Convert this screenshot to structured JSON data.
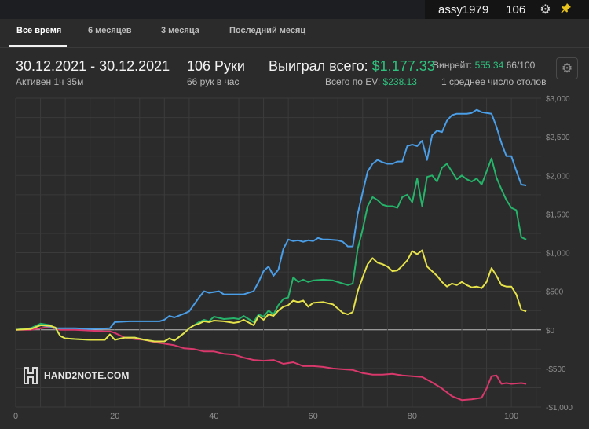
{
  "user": {
    "name": "assy1979",
    "hands": "106"
  },
  "tabs": [
    {
      "label": "Все время",
      "active": true
    },
    {
      "label": "6 месяцев",
      "active": false
    },
    {
      "label": "3 месяца",
      "active": false
    },
    {
      "label": "Последний месяц",
      "active": false
    }
  ],
  "summary": {
    "date_range": "30.12.2021 - 30.12.2021",
    "active": "Активен 1ч 35м",
    "hands": "106 Руки",
    "hands_rate": "66 рук в час",
    "won_label": "Выиграл всего: ",
    "won_value": "$1,177.33",
    "ev_label": "Всего по EV: ",
    "ev_value": "$238.13",
    "winrate_label": "Винрейт: ",
    "winrate_value": "555.34",
    "winrate_suffix": " 66/100",
    "tables": "1 среднее число столов"
  },
  "logo_text": "HAND2NOTE.COM",
  "colors": {
    "background": "#2b2b2b",
    "accent_green": "#2ec27e",
    "series_blue": "#4a9ee8",
    "series_green": "#25b46a",
    "series_yellow": "#e6e24a",
    "series_red": "#d8386b"
  },
  "chart_data": {
    "type": "line",
    "grid": true,
    "xlim": [
      0,
      106
    ],
    "ylim": [
      -1000,
      3000
    ],
    "x_ticks": [
      "0",
      "20",
      "40",
      "60",
      "80",
      "100"
    ],
    "y_ticks": [
      "$3,000",
      "$2,500",
      "$2,000",
      "$1,500",
      "$1,000",
      "$500",
      "$0",
      "-$500",
      "-$1,000"
    ],
    "series": [
      {
        "color": "#4a9ee8",
        "points": [
          [
            0,
            0
          ],
          [
            3,
            20
          ],
          [
            5,
            60
          ],
          [
            7,
            40
          ],
          [
            8,
            20
          ],
          [
            12,
            20
          ],
          [
            15,
            10
          ],
          [
            19,
            20
          ],
          [
            20,
            100
          ],
          [
            23,
            110
          ],
          [
            27,
            110
          ],
          [
            29,
            110
          ],
          [
            30,
            130
          ],
          [
            31,
            180
          ],
          [
            32,
            160
          ],
          [
            34,
            210
          ],
          [
            35,
            240
          ],
          [
            37,
            420
          ],
          [
            38,
            500
          ],
          [
            39,
            480
          ],
          [
            41,
            500
          ],
          [
            42,
            460
          ],
          [
            44,
            460
          ],
          [
            46,
            460
          ],
          [
            48,
            500
          ],
          [
            49,
            620
          ],
          [
            50,
            760
          ],
          [
            51,
            820
          ],
          [
            52,
            700
          ],
          [
            53,
            780
          ],
          [
            54,
            1050
          ],
          [
            55,
            1170
          ],
          [
            56,
            1150
          ],
          [
            57,
            1160
          ],
          [
            58,
            1140
          ],
          [
            59,
            1160
          ],
          [
            60,
            1150
          ],
          [
            61,
            1190
          ],
          [
            62,
            1170
          ],
          [
            63,
            1170
          ],
          [
            65,
            1160
          ],
          [
            66,
            1140
          ],
          [
            67,
            1080
          ],
          [
            68,
            1080
          ],
          [
            69,
            1500
          ],
          [
            70,
            1780
          ],
          [
            71,
            2050
          ],
          [
            72,
            2150
          ],
          [
            73,
            2200
          ],
          [
            74,
            2170
          ],
          [
            75,
            2150
          ],
          [
            76,
            2150
          ],
          [
            77,
            2180
          ],
          [
            78,
            2180
          ],
          [
            79,
            2380
          ],
          [
            80,
            2400
          ],
          [
            81,
            2380
          ],
          [
            82,
            2450
          ],
          [
            83,
            2200
          ],
          [
            84,
            2520
          ],
          [
            85,
            2580
          ],
          [
            86,
            2560
          ],
          [
            87,
            2710
          ],
          [
            88,
            2780
          ],
          [
            89,
            2800
          ],
          [
            90,
            2800
          ],
          [
            91,
            2800
          ],
          [
            92,
            2810
          ],
          [
            93,
            2850
          ],
          [
            94,
            2820
          ],
          [
            96,
            2800
          ],
          [
            97,
            2630
          ],
          [
            98,
            2420
          ],
          [
            99,
            2250
          ],
          [
            100,
            2250
          ],
          [
            101,
            2060
          ],
          [
            102,
            1880
          ],
          [
            103,
            1870
          ]
        ]
      },
      {
        "color": "#25b46a",
        "points": [
          [
            0,
            0
          ],
          [
            3,
            20
          ],
          [
            5,
            80
          ],
          [
            7,
            60
          ],
          [
            8,
            20
          ],
          [
            9,
            -80
          ],
          [
            10,
            -110
          ],
          [
            12,
            -120
          ],
          [
            15,
            -130
          ],
          [
            18,
            -130
          ],
          [
            19,
            -60
          ],
          [
            20,
            -130
          ],
          [
            22,
            -100
          ],
          [
            24,
            -100
          ],
          [
            26,
            -130
          ],
          [
            28,
            -150
          ],
          [
            30,
            -150
          ],
          [
            31,
            -110
          ],
          [
            32,
            -140
          ],
          [
            33,
            -90
          ],
          [
            34,
            -40
          ],
          [
            35,
            20
          ],
          [
            36,
            60
          ],
          [
            37,
            100
          ],
          [
            38,
            130
          ],
          [
            39,
            110
          ],
          [
            40,
            170
          ],
          [
            42,
            140
          ],
          [
            44,
            150
          ],
          [
            45,
            140
          ],
          [
            46,
            180
          ],
          [
            48,
            100
          ],
          [
            49,
            200
          ],
          [
            50,
            170
          ],
          [
            51,
            250
          ],
          [
            52,
            200
          ],
          [
            53,
            320
          ],
          [
            54,
            400
          ],
          [
            55,
            420
          ],
          [
            56,
            680
          ],
          [
            57,
            620
          ],
          [
            58,
            650
          ],
          [
            59,
            620
          ],
          [
            60,
            640
          ],
          [
            62,
            650
          ],
          [
            64,
            640
          ],
          [
            66,
            600
          ],
          [
            67,
            580
          ],
          [
            68,
            600
          ],
          [
            69,
            1050
          ],
          [
            70,
            1300
          ],
          [
            71,
            1600
          ],
          [
            72,
            1720
          ],
          [
            73,
            1680
          ],
          [
            74,
            1620
          ],
          [
            75,
            1600
          ],
          [
            76,
            1600
          ],
          [
            77,
            1580
          ],
          [
            78,
            1720
          ],
          [
            79,
            1750
          ],
          [
            80,
            1650
          ],
          [
            81,
            1960
          ],
          [
            82,
            1600
          ],
          [
            83,
            1980
          ],
          [
            84,
            2000
          ],
          [
            85,
            1920
          ],
          [
            86,
            2100
          ],
          [
            87,
            2150
          ],
          [
            88,
            2050
          ],
          [
            89,
            1950
          ],
          [
            90,
            2000
          ],
          [
            91,
            1950
          ],
          [
            92,
            1920
          ],
          [
            93,
            1960
          ],
          [
            94,
            1880
          ],
          [
            95,
            2050
          ],
          [
            96,
            2220
          ],
          [
            97,
            1970
          ],
          [
            98,
            1820
          ],
          [
            99,
            1680
          ],
          [
            100,
            1580
          ],
          [
            101,
            1550
          ],
          [
            102,
            1200
          ],
          [
            103,
            1170
          ]
        ]
      },
      {
        "color": "#e6e24a",
        "points": [
          [
            0,
            0
          ],
          [
            3,
            10
          ],
          [
            5,
            60
          ],
          [
            7,
            50
          ],
          [
            8,
            30
          ],
          [
            9,
            -80
          ],
          [
            10,
            -110
          ],
          [
            12,
            -120
          ],
          [
            15,
            -130
          ],
          [
            18,
            -130
          ],
          [
            19,
            -60
          ],
          [
            20,
            -130
          ],
          [
            22,
            -100
          ],
          [
            24,
            -100
          ],
          [
            26,
            -130
          ],
          [
            28,
            -150
          ],
          [
            30,
            -150
          ],
          [
            31,
            -110
          ],
          [
            32,
            -140
          ],
          [
            33,
            -90
          ],
          [
            34,
            -40
          ],
          [
            35,
            20
          ],
          [
            36,
            60
          ],
          [
            37,
            80
          ],
          [
            38,
            110
          ],
          [
            39,
            100
          ],
          [
            40,
            120
          ],
          [
            42,
            110
          ],
          [
            44,
            90
          ],
          [
            45,
            100
          ],
          [
            46,
            130
          ],
          [
            48,
            60
          ],
          [
            49,
            180
          ],
          [
            50,
            130
          ],
          [
            51,
            200
          ],
          [
            52,
            180
          ],
          [
            53,
            250
          ],
          [
            54,
            300
          ],
          [
            55,
            320
          ],
          [
            56,
            380
          ],
          [
            57,
            360
          ],
          [
            58,
            380
          ],
          [
            59,
            300
          ],
          [
            60,
            350
          ],
          [
            62,
            360
          ],
          [
            64,
            330
          ],
          [
            66,
            220
          ],
          [
            67,
            200
          ],
          [
            68,
            230
          ],
          [
            69,
            500
          ],
          [
            70,
            680
          ],
          [
            71,
            850
          ],
          [
            72,
            930
          ],
          [
            73,
            870
          ],
          [
            74,
            850
          ],
          [
            75,
            820
          ],
          [
            76,
            760
          ],
          [
            77,
            770
          ],
          [
            78,
            830
          ],
          [
            79,
            900
          ],
          [
            80,
            1020
          ],
          [
            81,
            980
          ],
          [
            82,
            1030
          ],
          [
            83,
            820
          ],
          [
            84,
            760
          ],
          [
            85,
            700
          ],
          [
            86,
            620
          ],
          [
            87,
            560
          ],
          [
            88,
            600
          ],
          [
            89,
            580
          ],
          [
            90,
            620
          ],
          [
            91,
            580
          ],
          [
            92,
            550
          ],
          [
            93,
            560
          ],
          [
            94,
            540
          ],
          [
            95,
            620
          ],
          [
            96,
            800
          ],
          [
            97,
            700
          ],
          [
            98,
            580
          ],
          [
            99,
            560
          ],
          [
            100,
            560
          ],
          [
            101,
            460
          ],
          [
            102,
            260
          ],
          [
            103,
            240
          ]
        ]
      },
      {
        "color": "#d8386b",
        "points": [
          [
            0,
            0
          ],
          [
            3,
            0
          ],
          [
            5,
            20
          ],
          [
            7,
            40
          ],
          [
            8,
            10
          ],
          [
            9,
            0
          ],
          [
            12,
            0
          ],
          [
            15,
            -10
          ],
          [
            18,
            -20
          ],
          [
            19,
            -20
          ],
          [
            20,
            -40
          ],
          [
            22,
            -100
          ],
          [
            24,
            -120
          ],
          [
            26,
            -130
          ],
          [
            28,
            -160
          ],
          [
            30,
            -180
          ],
          [
            32,
            -200
          ],
          [
            34,
            -240
          ],
          [
            36,
            -250
          ],
          [
            38,
            -280
          ],
          [
            40,
            -280
          ],
          [
            42,
            -310
          ],
          [
            44,
            -320
          ],
          [
            46,
            -360
          ],
          [
            48,
            -390
          ],
          [
            50,
            -400
          ],
          [
            52,
            -390
          ],
          [
            54,
            -440
          ],
          [
            56,
            -420
          ],
          [
            58,
            -470
          ],
          [
            60,
            -470
          ],
          [
            62,
            -480
          ],
          [
            64,
            -500
          ],
          [
            66,
            -510
          ],
          [
            68,
            -520
          ],
          [
            70,
            -560
          ],
          [
            72,
            -580
          ],
          [
            74,
            -580
          ],
          [
            76,
            -570
          ],
          [
            78,
            -590
          ],
          [
            80,
            -600
          ],
          [
            82,
            -610
          ],
          [
            84,
            -680
          ],
          [
            86,
            -760
          ],
          [
            88,
            -860
          ],
          [
            90,
            -910
          ],
          [
            92,
            -900
          ],
          [
            94,
            -880
          ],
          [
            95,
            -760
          ],
          [
            96,
            -600
          ],
          [
            97,
            -590
          ],
          [
            98,
            -700
          ],
          [
            99,
            -690
          ],
          [
            100,
            -700
          ],
          [
            102,
            -690
          ],
          [
            103,
            -700
          ]
        ]
      }
    ]
  }
}
